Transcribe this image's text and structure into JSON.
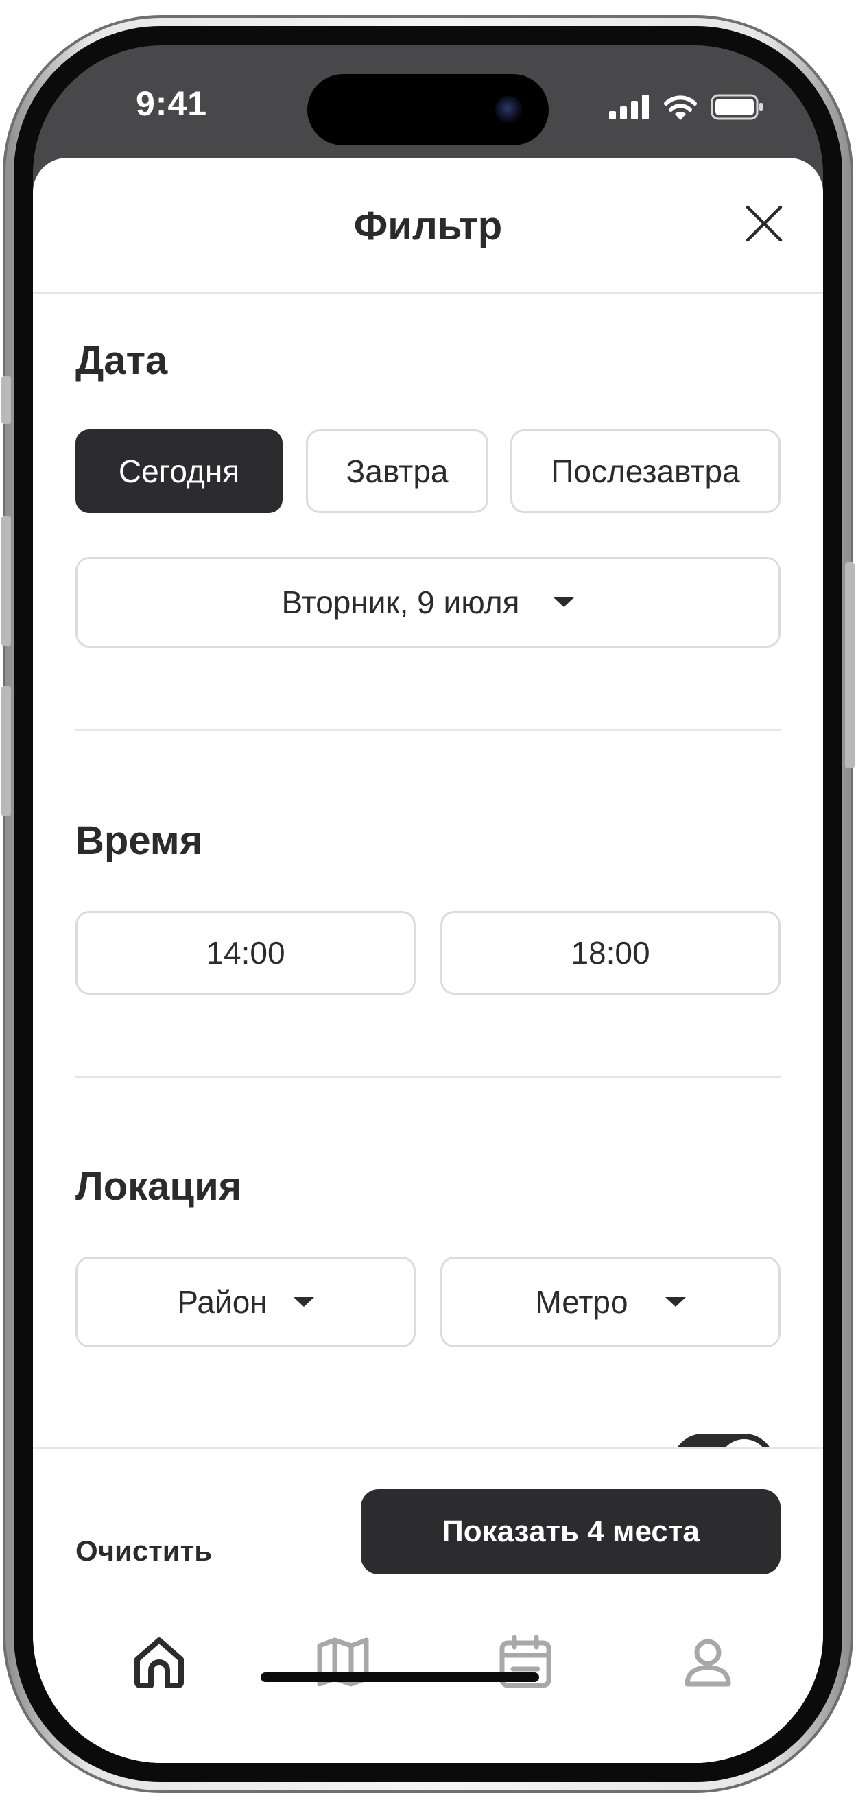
{
  "status_bar": {
    "time": "9:41",
    "icons": [
      "cellular-signal-icon",
      "wifi-icon",
      "battery-icon"
    ]
  },
  "sheet": {
    "title": "Фильтр",
    "close_icon": "close-icon"
  },
  "date_section": {
    "title": "Дата",
    "chips": [
      {
        "label": "Сегодня",
        "selected": true
      },
      {
        "label": "Завтра",
        "selected": false
      },
      {
        "label": "Послезавтра",
        "selected": false
      }
    ],
    "date_select": {
      "value": "Вторник, 9 июля"
    }
  },
  "time_section": {
    "title": "Время",
    "from": "14:00",
    "to": "18:00"
  },
  "location_section": {
    "title": "Локация",
    "district_select": "Район",
    "metro_select": "Метро"
  },
  "footer": {
    "clear_label": "Очистить",
    "show_label": "Показать 4 места"
  },
  "tab_bar": {
    "items": [
      {
        "icon": "home-icon",
        "active": true
      },
      {
        "icon": "map-icon",
        "active": false
      },
      {
        "icon": "calendar-icon",
        "active": false
      },
      {
        "icon": "profile-icon",
        "active": false
      }
    ]
  },
  "colors": {
    "primary": "#2c2c2e",
    "border": "#dcdcdc",
    "inactive_icon": "#a8a8a8",
    "background": "#ffffff"
  }
}
